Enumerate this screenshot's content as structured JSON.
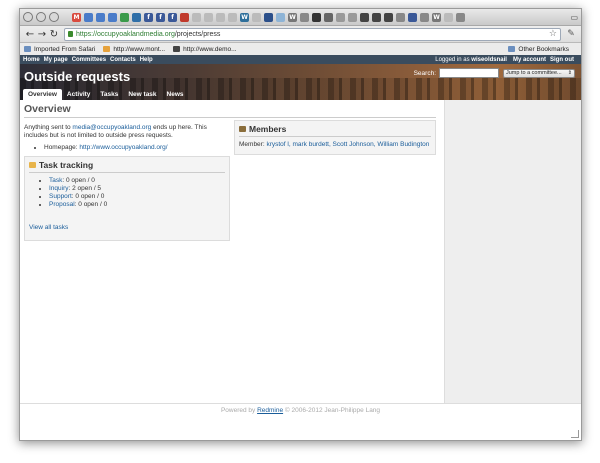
{
  "browser": {
    "url_host": "https://occupyoaklandmedia.org",
    "url_path": "/projects/press",
    "bookmarks": [
      {
        "label": "Imported From Safari",
        "color": "#6b8fbf"
      },
      {
        "label": "http://www.mont...",
        "color": "#e6a23c"
      },
      {
        "label": "http://www.demo...",
        "color": "#444444"
      }
    ],
    "other_bookmarks": "Other Bookmarks",
    "tab_icons": [
      {
        "name": "gmail-icon",
        "color": "#d94b3f",
        "glyph": "M"
      },
      {
        "name": "doc-icon",
        "color": "#4a7cc9",
        "glyph": ""
      },
      {
        "name": "doc-icon",
        "color": "#4a7cc9",
        "glyph": ""
      },
      {
        "name": "doc-icon",
        "color": "#4a7cc9",
        "glyph": ""
      },
      {
        "name": "sheet-icon",
        "color": "#3a9a4a",
        "glyph": ""
      },
      {
        "name": "globe-icon",
        "color": "#2f6fa8",
        "glyph": ""
      },
      {
        "name": "facebook-icon",
        "color": "#3b5998",
        "glyph": "f"
      },
      {
        "name": "facebook-icon",
        "color": "#3b5998",
        "glyph": "f"
      },
      {
        "name": "facebook-icon",
        "color": "#3b5998",
        "glyph": "f"
      },
      {
        "name": "app-icon",
        "color": "#c0392b",
        "glyph": ""
      },
      {
        "name": "page-icon",
        "color": "#bbbbbb",
        "glyph": ""
      },
      {
        "name": "page-icon",
        "color": "#bbbbbb",
        "glyph": ""
      },
      {
        "name": "page-icon",
        "color": "#bbbbbb",
        "glyph": ""
      },
      {
        "name": "page-icon",
        "color": "#bbbbbb",
        "glyph": ""
      },
      {
        "name": "wordpress-icon",
        "color": "#2e6f9b",
        "glyph": "W"
      },
      {
        "name": "page-icon",
        "color": "#bbbbbb",
        "glyph": ""
      },
      {
        "name": "grid-icon",
        "color": "#2b4f8a",
        "glyph": ""
      },
      {
        "name": "page-icon",
        "color": "#8eb4d6",
        "glyph": ""
      },
      {
        "name": "wikipedia-icon",
        "color": "#777777",
        "glyph": "W"
      },
      {
        "name": "page-icon",
        "color": "#888888",
        "glyph": ""
      },
      {
        "name": "circle-icon",
        "color": "#333333",
        "glyph": ""
      },
      {
        "name": "page-icon",
        "color": "#666666",
        "glyph": ""
      },
      {
        "name": "page-icon",
        "color": "#999999",
        "glyph": ""
      },
      {
        "name": "page-icon",
        "color": "#999999",
        "glyph": ""
      },
      {
        "name": "page-icon",
        "color": "#444444",
        "glyph": ""
      },
      {
        "name": "page-icon",
        "color": "#444444",
        "glyph": ""
      },
      {
        "name": "page-icon",
        "color": "#444444",
        "glyph": ""
      },
      {
        "name": "page-icon",
        "color": "#888888",
        "glyph": ""
      },
      {
        "name": "page-icon",
        "color": "#3b5998",
        "glyph": ""
      },
      {
        "name": "page-icon",
        "color": "#888888",
        "glyph": ""
      },
      {
        "name": "wikipedia-icon",
        "color": "#777777",
        "glyph": "W"
      },
      {
        "name": "page-icon",
        "color": "#bbbbbb",
        "glyph": ""
      },
      {
        "name": "page-icon",
        "color": "#888888",
        "glyph": ""
      }
    ]
  },
  "topmenu": {
    "items": [
      "Home",
      "My page",
      "Committees",
      "Contacts",
      "Help"
    ],
    "logged_in_prefix": "Logged in as",
    "username": "wiseoldsnail",
    "my_account": "My account",
    "sign_out": "Sign out"
  },
  "header": {
    "title": "Outside requests",
    "search_label": "Search:",
    "jump_label": "Jump to a committee...",
    "tabs": [
      "Overview",
      "Activity",
      "Tasks",
      "New task",
      "News"
    ]
  },
  "overview": {
    "heading": "Overview",
    "desc_prefix": "Anything sent to ",
    "desc_email": "media@occupyoakland.org",
    "desc_suffix": " ends up here. This includes but is not limited to outside press requests.",
    "homepage_label": "Homepage: ",
    "homepage_url": "http://www.occupyoakland.org/"
  },
  "task_tracking": {
    "heading": "Task tracking",
    "items": [
      {
        "name": "Task",
        "count": ": 0 open / 0"
      },
      {
        "name": "Inquiry",
        "count": ": 2 open / 5"
      },
      {
        "name": "Support",
        "count": ": 0 open / 0"
      },
      {
        "name": "Proposal",
        "count": ": 0 open / 0"
      }
    ],
    "view_all": "View all tasks"
  },
  "members": {
    "heading": "Members",
    "label": "Member: ",
    "names": "krystof l, mark burdett, Scott Johnson, William Budington"
  },
  "footer": {
    "prefix": "Powered by ",
    "link": "Redmine",
    "suffix": " © 2006-2012 Jean-Philippe Lang"
  },
  "colors": {
    "topmenu_bg": "#3a4c5e",
    "link": "#1a5d9a"
  }
}
